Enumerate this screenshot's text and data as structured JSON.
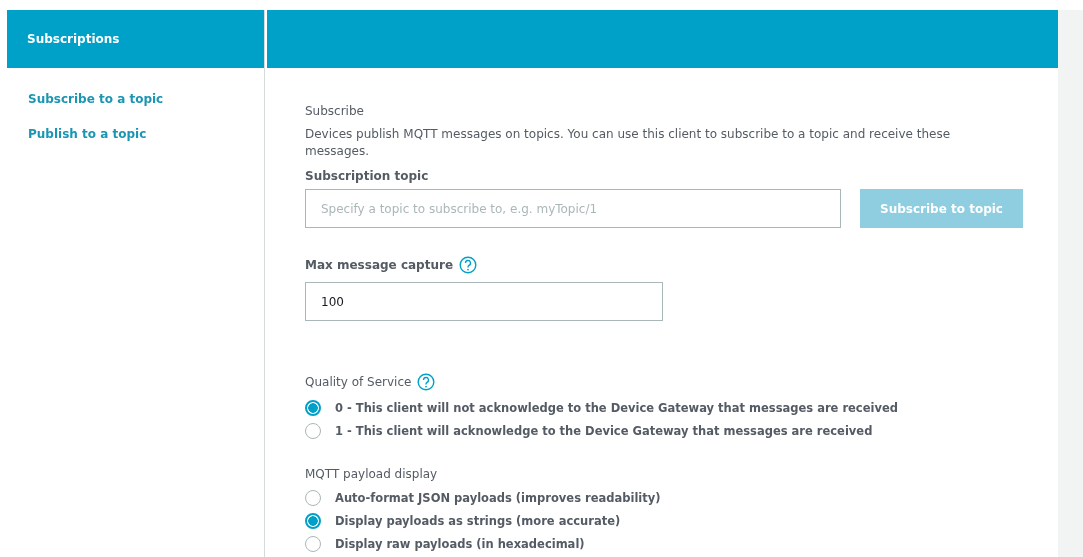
{
  "sidebar": {
    "title": "Subscriptions",
    "items": [
      {
        "label": "Subscribe to a topic"
      },
      {
        "label": "Publish to a topic"
      }
    ]
  },
  "subscribe": {
    "title": "Subscribe",
    "description": "Devices publish MQTT messages on topics. You can use this client to subscribe to a topic and receive these messages.",
    "topic_field": {
      "label": "Subscription topic",
      "placeholder": "Specify a topic to subscribe to, e.g. myTopic/1"
    },
    "subscribe_button": {
      "label": "Subscribe to topic",
      "disabled": true
    },
    "max_capture": {
      "label": "Max message capture",
      "value": "100"
    },
    "qos": {
      "label": "Quality of Service",
      "options": [
        {
          "label": "0 - This client will not acknowledge to the Device Gateway that messages are received",
          "selected": true
        },
        {
          "label": "1 - This client will acknowledge to the Device Gateway that messages are received",
          "selected": false
        }
      ]
    },
    "payload_display": {
      "label": "MQTT payload display",
      "options": [
        {
          "label": "Auto-format JSON payloads (improves readability)",
          "selected": false
        },
        {
          "label": "Display payloads as strings (more accurate)",
          "selected": true
        },
        {
          "label": "Display raw payloads (in hexadecimal)",
          "selected": false
        }
      ]
    }
  }
}
